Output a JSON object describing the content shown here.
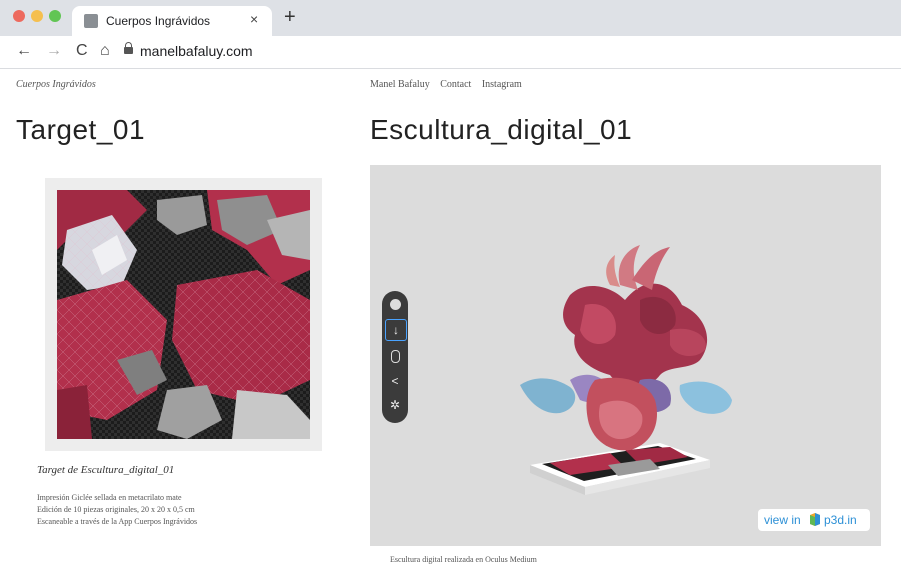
{
  "browser": {
    "tab_title": "Cuerpos Ingrávidos",
    "tab_close": "×",
    "new_tab": "+",
    "url": "manelbafaluy.com",
    "nav_back": "←",
    "nav_forward": "→",
    "nav_reload": "C",
    "nav_home": "⌂"
  },
  "page": {
    "site_name": "Cuerpos Ingrávidos",
    "nav_links": [
      "Manel Bafaluy",
      "Contact",
      "Instagram"
    ],
    "left_title": "Target_01",
    "right_title": "Escultura_digital_01",
    "target_caption": "Target de Escultura_digital_01",
    "target_description": [
      "Impresión Giclée sellada en metacrilato mate",
      "Edición de 10 piezas originales, 20 x 20 x 0,5 cm",
      "Escaneable a través de la App Cuerpos Ingrávidos"
    ],
    "viewer_badge_view": "view in",
    "viewer_badge_brand": "p3d.in",
    "sculpture_caption": "Escultura digital realizada en Oculus Medium"
  },
  "icons": {
    "sphere": "sphere-icon",
    "arrow_down": "arrow-down-icon",
    "mouse": "mouse-icon",
    "share": "share-icon",
    "focus": "focus-icon"
  },
  "colors": {
    "accent": "#2d90d6",
    "crimson": "#b2304c",
    "toolbar_bg": "#3b3b3b"
  }
}
